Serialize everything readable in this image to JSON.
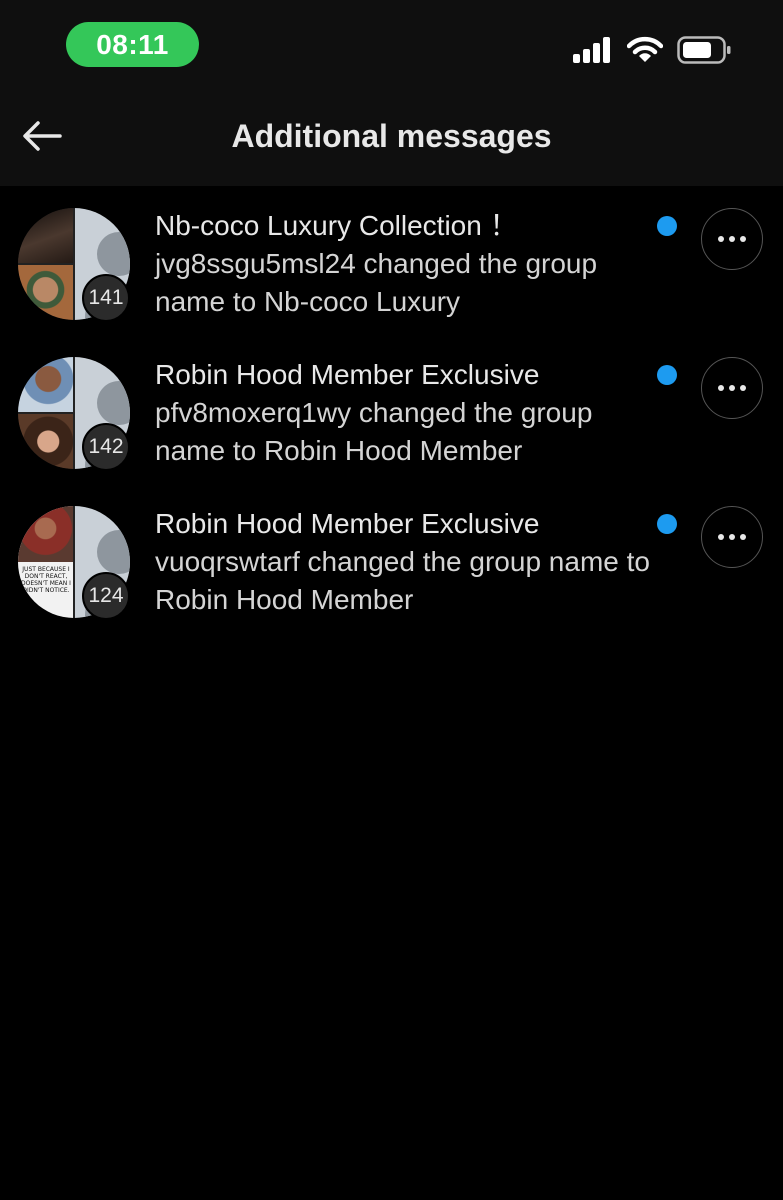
{
  "status_bar": {
    "time": "08:11",
    "icons": [
      "cellular-signal-icon",
      "wifi-icon",
      "battery-icon"
    ],
    "accent_color": "#34c759"
  },
  "header": {
    "title": "Additional messages",
    "back_icon": "back-arrow-icon"
  },
  "conversations": [
    {
      "title": "Nb-coco Luxury Collection ！",
      "preview": "jvg8ssgu5msl24 changed the group name to Nb-coco Luxury",
      "member_count": "141",
      "unread": true,
      "avatar_colors": [
        "#3a2a22",
        "#7a5a3a"
      ]
    },
    {
      "title": "Robin Hood Member Exclusive",
      "preview": "pfv8moxerq1wy changed the group name to Robin Hood Member",
      "member_count": "142",
      "unread": true,
      "avatar_colors": [
        "#5d7aa0",
        "#8a5a48"
      ]
    },
    {
      "title": "Robin Hood Member Exclusive",
      "preview": "vuoqrswtarf changed the group name to Robin Hood Member",
      "member_count": "124",
      "unread": true,
      "avatar_colors": [
        "#8a3a30",
        "#f2f2f2"
      ],
      "avatar_caption": "JUST BECAUSE I DON'T REACT, DOESN'T MEAN I DIDN'T NOTICE."
    }
  ],
  "colors": {
    "unread_dot": "#1d9bf0",
    "background": "#000000"
  }
}
